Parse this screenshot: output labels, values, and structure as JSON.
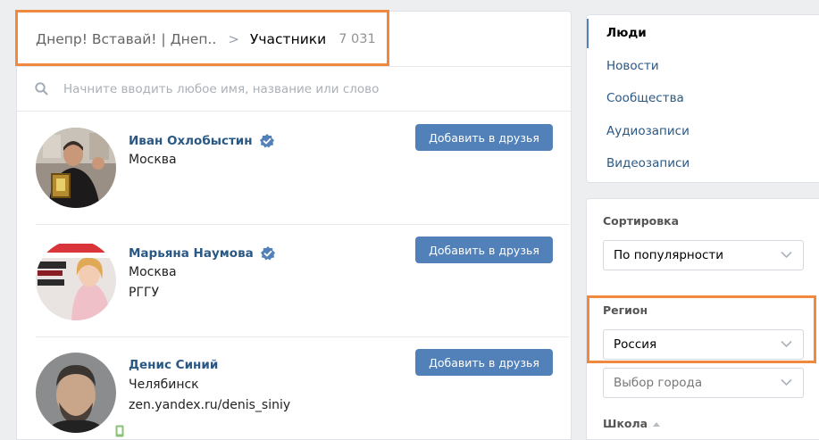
{
  "breadcrumb": {
    "group": "Днепр! Вставай! | Днеп..",
    "separator": ">",
    "current": "Участники",
    "count": "7 031"
  },
  "search": {
    "placeholder": "Начните вводить любое имя, название или слово"
  },
  "members": [
    {
      "name": "Иван Охлобыстин",
      "verified": true,
      "city": "Москва",
      "extra": "",
      "button": "Добавить в друзья"
    },
    {
      "name": "Марьяна Наумова",
      "verified": true,
      "city": "Москва",
      "extra": "РГГУ",
      "button": "Добавить в друзья"
    },
    {
      "name": "Денис Синий",
      "verified": false,
      "city": "Челябинск",
      "extra": "zen.yandex.ru/denis_siniy",
      "button": "Добавить в друзья"
    }
  ],
  "nav": {
    "items": [
      {
        "label": "Люди",
        "active": true
      },
      {
        "label": "Новости"
      },
      {
        "label": "Сообщества"
      },
      {
        "label": "Аудиозаписи"
      },
      {
        "label": "Видеозаписи"
      }
    ]
  },
  "filters": {
    "sort_label": "Сортировка",
    "sort_value": "По популярности",
    "region_label": "Регион",
    "region_value": "Россия",
    "city_placeholder": "Выбор города",
    "school_label": "Школа"
  },
  "colors": {
    "link": "#2a5885",
    "button": "#5181b8",
    "highlight": "#f0883e",
    "background": "#edeef0",
    "verified": "#5181b8"
  }
}
